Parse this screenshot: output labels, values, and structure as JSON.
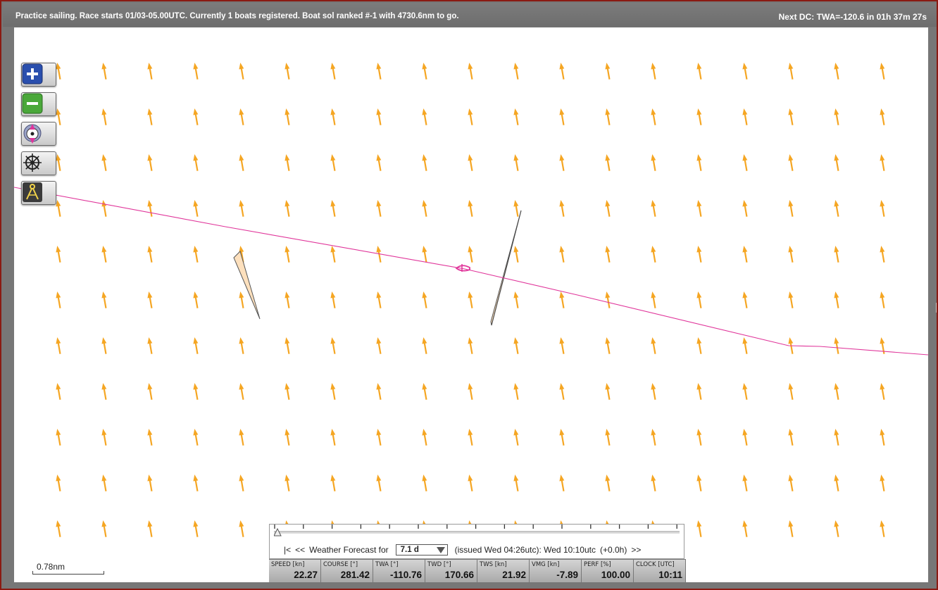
{
  "header": {
    "status": "Practice sailing. Race starts 01/03-05.00UTC. Currently 1 boats registered. Boat sol ranked #-1 with 4730.6nm to go.",
    "next_dc": "Next DC: TWA=-120.6 in 01h 37m 27s"
  },
  "map": {
    "wind_arrow_color": "#f5a623",
    "route_color": "#e0359a",
    "boat_color": "#e0359a",
    "scale_label": "0.78nm",
    "controls": [
      {
        "name": "zoom-in",
        "icon": "plus-icon"
      },
      {
        "name": "zoom-out",
        "icon": "minus-icon"
      },
      {
        "name": "center-boat",
        "icon": "compass-pin-icon"
      },
      {
        "name": "steering",
        "icon": "ship-wheel-icon"
      },
      {
        "name": "measure",
        "icon": "divider-compass-icon"
      }
    ]
  },
  "forecast": {
    "first": "|<",
    "prev": "<<",
    "label": "Weather Forecast for",
    "range": "7.1 d",
    "issued": "(issued Wed 04:26utc): Wed 10:10utc",
    "offset": "(+0.0h)",
    "next": ">>"
  },
  "instruments": [
    {
      "label": "SPEED [kn]",
      "value": "22.27"
    },
    {
      "label": "COURSE [°]",
      "value": "281.42"
    },
    {
      "label": "TWA [°]",
      "value": "-110.76"
    },
    {
      "label": "TWD [°]",
      "value": "170.66"
    },
    {
      "label": "TWS [kn]",
      "value": "21.92"
    },
    {
      "label": "VMG [kn]",
      "value": "-7.89"
    },
    {
      "label": "PERF [%]",
      "value": "100.00"
    },
    {
      "label": "CLOCK [UTC]",
      "value": "10:11"
    }
  ]
}
